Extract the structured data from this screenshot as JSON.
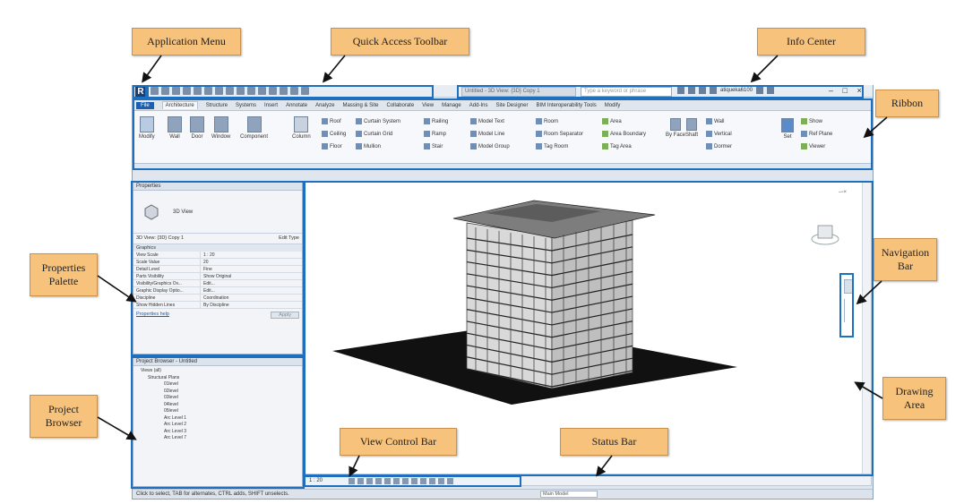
{
  "callouts": {
    "application_menu": "Application Menu",
    "quick_access_toolbar": "Quick Access Toolbar",
    "info_center": "Info Center",
    "ribbon": "Ribbon",
    "properties_palette": "Properties Palette",
    "navigation_bar": "Navigation Bar",
    "project_browser": "Project Browser",
    "drawing_area": "Drawing Area",
    "view_control_bar": "View Control Bar",
    "status_bar": "Status Bar"
  },
  "app": {
    "logo": "R",
    "search_placeholder": "Type a keyword or phrase",
    "title_field": "Untitled - 3D View: {3D} Copy 1",
    "user": "atiqueka6100",
    "tabs": [
      "File",
      "Architecture",
      "Structure",
      "Systems",
      "Insert",
      "Annotate",
      "Analyze",
      "Massing & Site",
      "Collaborate",
      "View",
      "Manage",
      "Add-Ins",
      "Site Designer",
      "BIM Interoperability Tools",
      "Modify"
    ],
    "active_tab": "Architecture"
  },
  "ribbon": {
    "buttons": [
      "Modify",
      "Wall",
      "Door",
      "Window",
      "Component",
      "Column"
    ],
    "build_small": [
      "Roof",
      "Curtain System",
      "Ceiling",
      "Curtain Grid",
      "Floor",
      "Mullion"
    ],
    "circ_small": [
      "Railing",
      "Ramp",
      "Stair"
    ],
    "model_small": [
      "Model Text",
      "Model Line",
      "Model Group"
    ],
    "room_small": [
      "Room",
      "Room Separator",
      "Tag Room"
    ],
    "area_small": [
      "Area",
      "Area Boundary",
      "Tag Area"
    ],
    "opening": [
      "By Face",
      "Shaft"
    ],
    "datum_small": [
      "Wall",
      "Vertical",
      "Dormer"
    ],
    "work_plane": [
      "Set",
      "Show",
      "Ref Plane",
      "Viewer"
    ]
  },
  "properties": {
    "title": "Properties",
    "type_name": "3D View",
    "selector": "3D View: {3D} Copy 1",
    "edit_type": "Edit Type",
    "section": "Graphics",
    "rows": [
      {
        "k": "View Scale",
        "v": "1 : 20"
      },
      {
        "k": "Scale Value",
        "v": "20"
      },
      {
        "k": "Detail Level",
        "v": "Fine"
      },
      {
        "k": "Parts Visibility",
        "v": "Show Original"
      },
      {
        "k": "Visibility/Graphics Ov...",
        "v": "Edit..."
      },
      {
        "k": "Graphic Display Optio...",
        "v": "Edit..."
      },
      {
        "k": "Discipline",
        "v": "Coordination"
      },
      {
        "k": "Show Hidden Lines",
        "v": "By Discipline"
      }
    ],
    "help": "Properties help",
    "apply": "Apply"
  },
  "browser": {
    "title": "Project Browser - Untitled",
    "items": [
      "Views (all)",
      "Structural Plans",
      "01level",
      "02level",
      "03level",
      "04level",
      "05level",
      "Arc Level 1",
      "Arc Level 2",
      "Arc Level 3",
      "Arc Level 7"
    ]
  },
  "status": {
    "text": "Click to select, TAB for alternates, CTRL adds, SHIFT unselects.",
    "model": "Main Model",
    "scale": "1 : 20"
  }
}
